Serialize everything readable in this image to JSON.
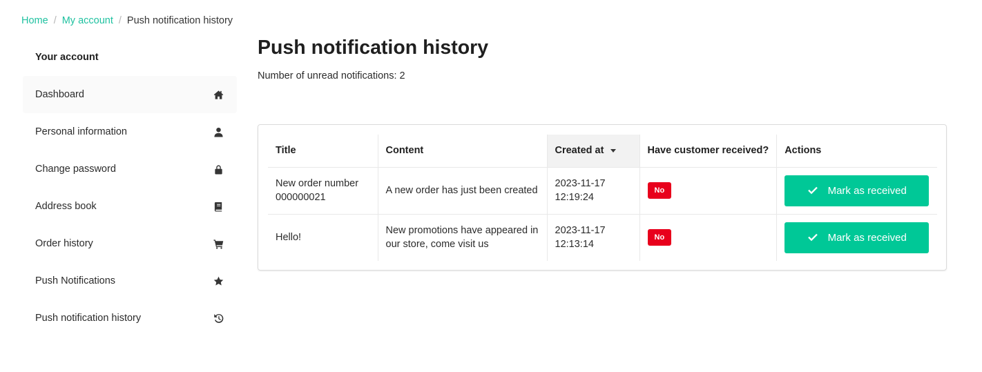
{
  "breadcrumb": {
    "home": "Home",
    "account": "My account",
    "current": "Push notification history",
    "separator": "/"
  },
  "sidebar": {
    "heading": "Your account",
    "items": [
      {
        "label": "Dashboard",
        "icon": "home-icon"
      },
      {
        "label": "Personal information",
        "icon": "user-icon"
      },
      {
        "label": "Change password",
        "icon": "lock-icon"
      },
      {
        "label": "Address book",
        "icon": "book-icon"
      },
      {
        "label": "Order history",
        "icon": "cart-icon"
      },
      {
        "label": "Push Notifications",
        "icon": "star-icon"
      },
      {
        "label": "Push notification history",
        "icon": "history-icon"
      }
    ]
  },
  "main": {
    "title": "Push notification history",
    "unread_label": "Number of unread notifications:",
    "unread_count": "2"
  },
  "table": {
    "columns": [
      "Title",
      "Content",
      "Created at",
      "Have customer received?",
      "Actions"
    ],
    "rows": [
      {
        "title": "New order number 000000021",
        "content": "A new order has just been created",
        "created_at": "2023-11-17 12:19:24",
        "received": "No",
        "action": "Mark as received"
      },
      {
        "title": "Hello!",
        "content": "New promotions have appeared in our store, come visit us",
        "created_at": "2023-11-17 12:13:14",
        "received": "No",
        "action": "Mark as received"
      }
    ]
  },
  "colors": {
    "link": "#1fc1a0",
    "button": "#00c897",
    "badge_no": "#e8001c"
  }
}
